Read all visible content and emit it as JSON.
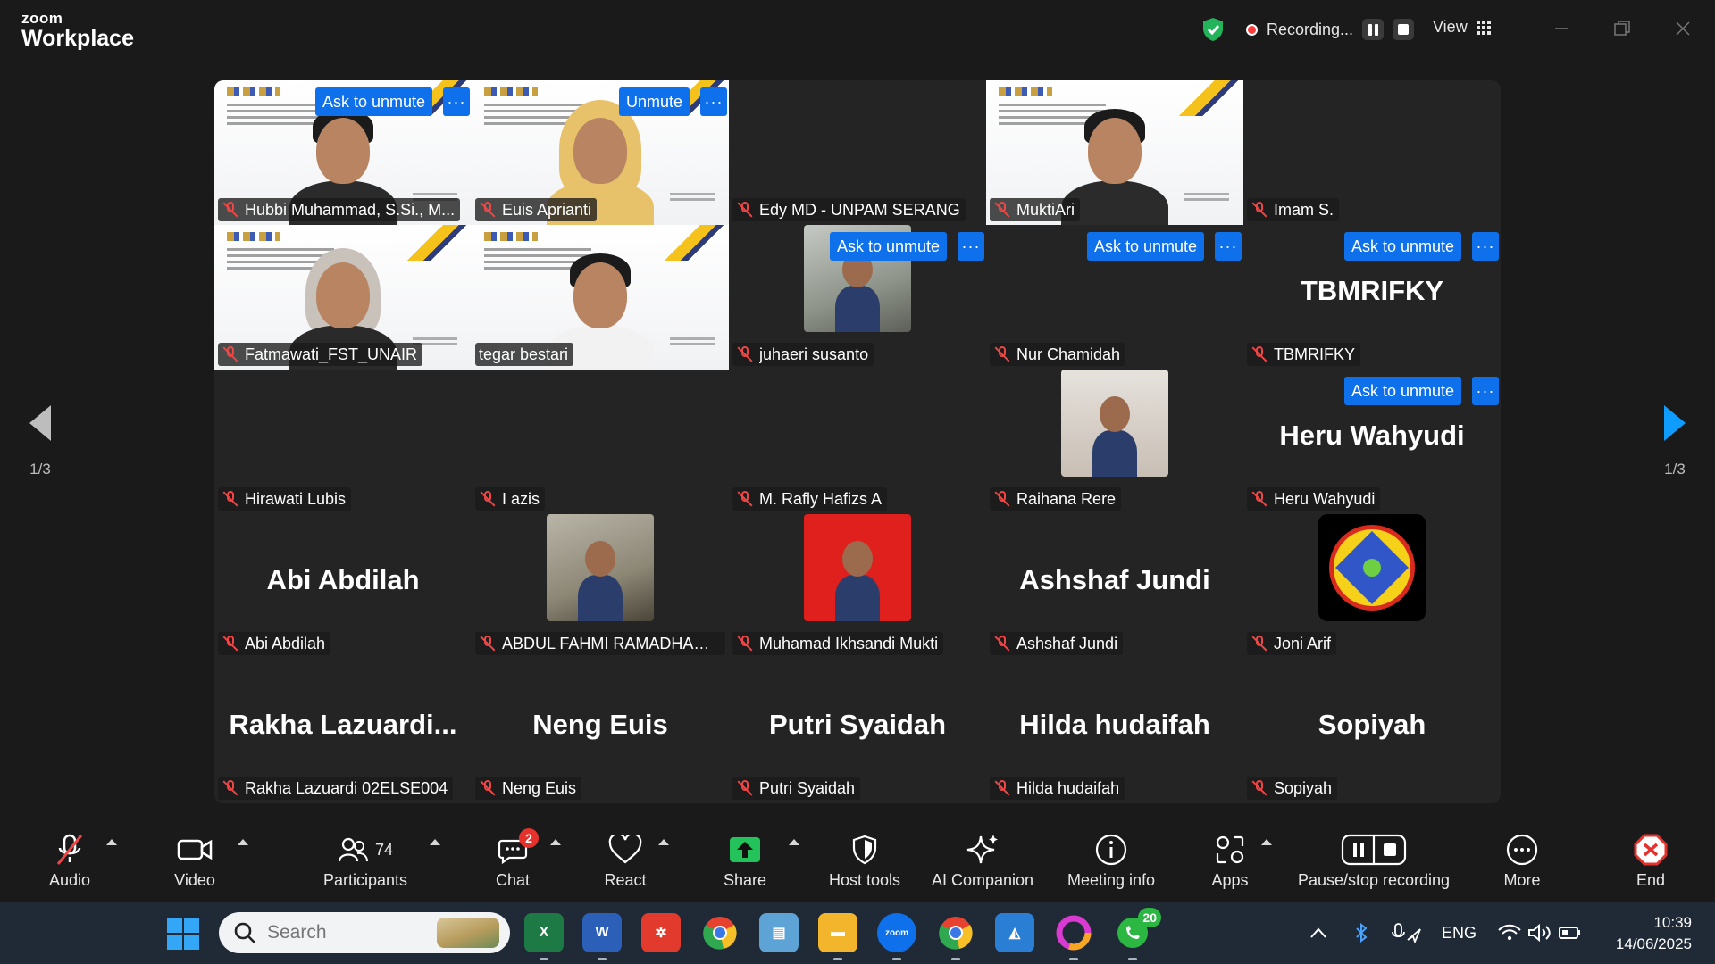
{
  "app": {
    "brand_top": "zoom",
    "brand_bottom": "Workplace"
  },
  "titlebar": {
    "recording_status": "Recording...",
    "view_label": "View"
  },
  "colors": {
    "accent": "#0e71eb",
    "active_speaker": "#23d96c",
    "muted": "#f04545",
    "record": "#ff3b3b"
  },
  "pager": {
    "left_count": "1/3",
    "right_count": "1/3"
  },
  "participants": [
    {
      "name": "Hubbi Muhammad, S.Si., M...",
      "button": "Ask to unmute",
      "video": "slide-man"
    },
    {
      "name": "Euis Aprianti",
      "button": "Unmute",
      "video": "slide-hijab-yellow"
    },
    {
      "name": "Edy MD - UNPAM SERANG",
      "button": "",
      "video": "none"
    },
    {
      "name": "MuktiAri",
      "button": "",
      "video": "slide-man"
    },
    {
      "name": "Imam S.",
      "button": "",
      "video": "none"
    },
    {
      "name": "Fatmawati_FST_UNAIR",
      "button": "",
      "video": "slide-hijab-gray"
    },
    {
      "name": "tegar bestari",
      "button": "",
      "video": "slide-man-white",
      "active": true
    },
    {
      "name": "juhaeri susanto",
      "button": "Ask to unmute",
      "video": "thumb-photo"
    },
    {
      "name": "Nur Chamidah",
      "button": "Ask to unmute",
      "video": "none"
    },
    {
      "name": "TBMRIFKY",
      "button": "Ask to unmute",
      "video": "bigname",
      "big": "TBMRIFKY"
    },
    {
      "name": "Hirawati Lubis",
      "button": "",
      "video": "none"
    },
    {
      "name": "I azis",
      "button": "",
      "video": "none"
    },
    {
      "name": "M. Rafly Hafizs A",
      "button": "",
      "video": "none"
    },
    {
      "name": "Raihana Rere",
      "button": "",
      "video": "thumb-face"
    },
    {
      "name": "Heru Wahyudi",
      "button": "Ask to unmute",
      "video": "bigname",
      "big": "Heru Wahyudi"
    },
    {
      "name": "Abi Abdilah",
      "button": "",
      "video": "bigname",
      "big": "Abi Abdilah"
    },
    {
      "name": "ABDUL FAHMI RAMADHAN ...",
      "button": "",
      "video": "thumb-room"
    },
    {
      "name": "Muhamad Ikhsandi Mukti",
      "button": "",
      "video": "thumb-red"
    },
    {
      "name": "Ashshaf Jundi",
      "button": "",
      "video": "bigname",
      "big": "Ashshaf Jundi"
    },
    {
      "name": "Joni Arif",
      "button": "",
      "video": "thumb-badge"
    },
    {
      "name": "Rakha Lazuardi 02ELSE004",
      "button": "",
      "video": "bigname",
      "big": "Rakha  Lazuardi..."
    },
    {
      "name": "Neng Euis",
      "button": "",
      "video": "bigname",
      "big": "Neng Euis"
    },
    {
      "name": "Putri Syaidah",
      "button": "",
      "video": "bigname",
      "big": "Putri Syaidah"
    },
    {
      "name": "Hilda hudaifah",
      "button": "",
      "video": "bigname",
      "big": "Hilda hudaifah"
    },
    {
      "name": "Sopiyah",
      "button": "",
      "video": "bigname",
      "big": "Sopiyah"
    }
  ],
  "toolbar": {
    "audio": "Audio",
    "video": "Video",
    "participants": "Participants",
    "participants_count": "74",
    "chat": "Chat",
    "chat_badge": "2",
    "react": "React",
    "share": "Share",
    "host_tools": "Host tools",
    "ai_companion": "AI Companion",
    "meeting_info": "Meeting info",
    "apps": "Apps",
    "pause_stop": "Pause/stop recording",
    "more": "More",
    "end": "End"
  },
  "taskbar": {
    "search_placeholder": "Search",
    "whatsapp_badge": "20",
    "language": "ENG",
    "time": "10:39",
    "date": "14/06/2025"
  }
}
